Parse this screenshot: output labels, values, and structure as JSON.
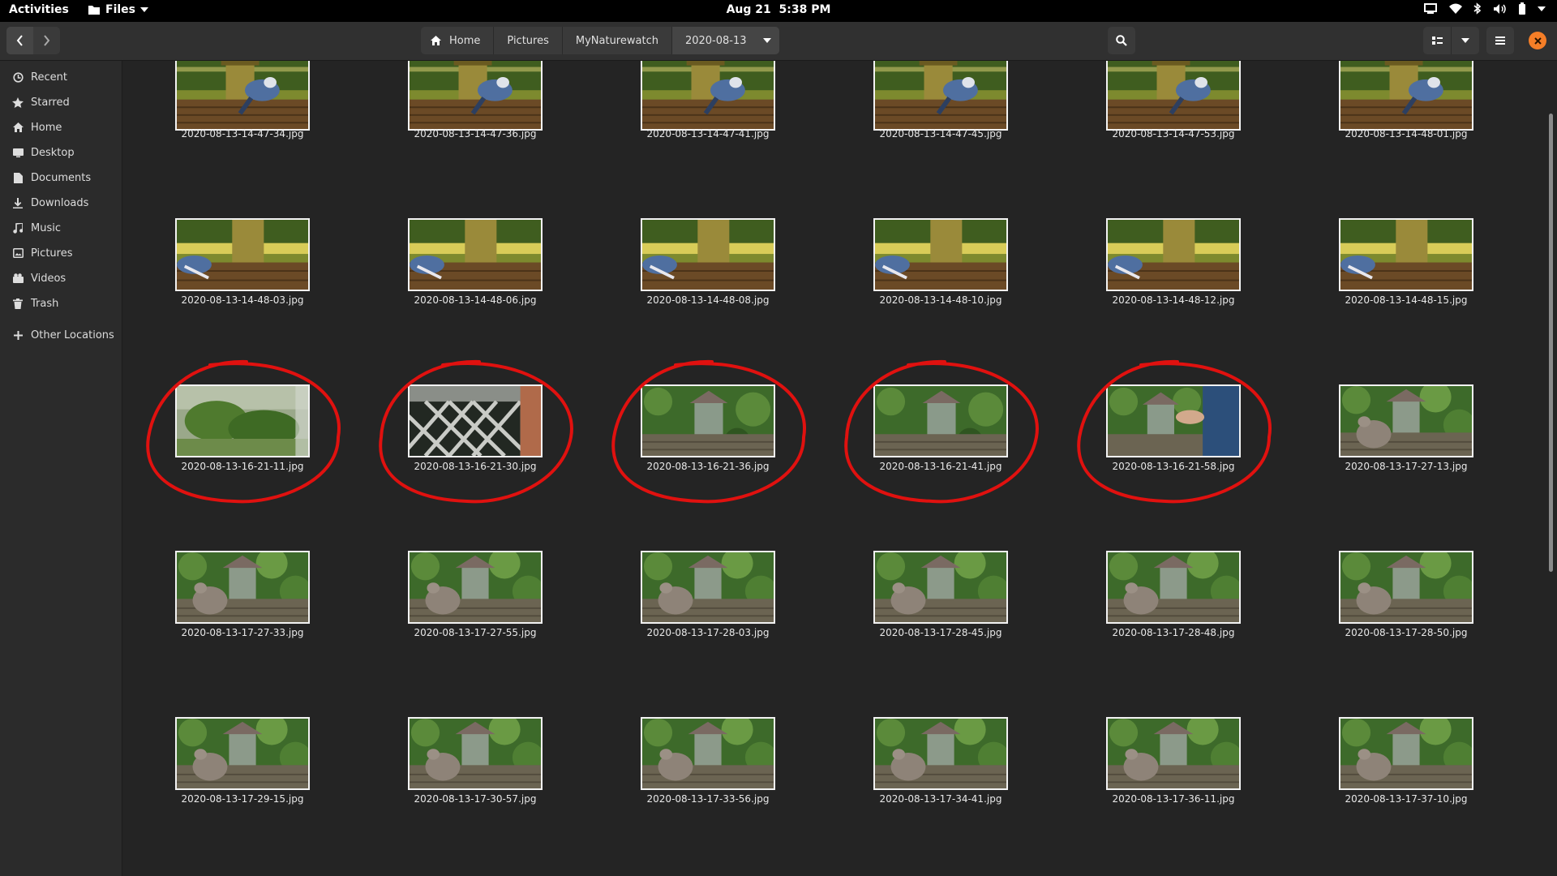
{
  "topbar": {
    "activities": "Activities",
    "app_name": "Files",
    "date": "Aug 21",
    "time": "5:38 PM"
  },
  "headerbar": {
    "breadcrumbs": [
      "Home",
      "Pictures",
      "MyNaturewatch",
      "2020-08-13"
    ]
  },
  "sidebar": {
    "items": [
      {
        "label": "Recent",
        "icon": "clock-icon"
      },
      {
        "label": "Starred",
        "icon": "star-icon"
      },
      {
        "label": "Home",
        "icon": "home-icon"
      },
      {
        "label": "Desktop",
        "icon": "desktop-icon"
      },
      {
        "label": "Documents",
        "icon": "document-icon"
      },
      {
        "label": "Downloads",
        "icon": "download-icon"
      },
      {
        "label": "Music",
        "icon": "music-icon"
      },
      {
        "label": "Pictures",
        "icon": "picture-icon"
      },
      {
        "label": "Videos",
        "icon": "video-icon"
      },
      {
        "label": "Trash",
        "icon": "trash-icon"
      },
      {
        "label": "Other Locations",
        "icon": "plus-icon"
      }
    ]
  },
  "files": [
    {
      "name": "2020-08-13-14-47-34.jpg",
      "scene": "jay"
    },
    {
      "name": "2020-08-13-14-47-36.jpg",
      "scene": "jay"
    },
    {
      "name": "2020-08-13-14-47-41.jpg",
      "scene": "jay"
    },
    {
      "name": "2020-08-13-14-47-45.jpg",
      "scene": "jay"
    },
    {
      "name": "2020-08-13-14-47-53.jpg",
      "scene": "jay"
    },
    {
      "name": "2020-08-13-14-48-01.jpg",
      "scene": "jay"
    },
    {
      "name": "2020-08-13-14-48-03.jpg",
      "scene": "jay2"
    },
    {
      "name": "2020-08-13-14-48-06.jpg",
      "scene": "jay2"
    },
    {
      "name": "2020-08-13-14-48-08.jpg",
      "scene": "jay2"
    },
    {
      "name": "2020-08-13-14-48-10.jpg",
      "scene": "jay2"
    },
    {
      "name": "2020-08-13-14-48-12.jpg",
      "scene": "jay2"
    },
    {
      "name": "2020-08-13-14-48-15.jpg",
      "scene": "jay2"
    },
    {
      "name": "2020-08-13-16-21-11.jpg",
      "scene": "blur"
    },
    {
      "name": "2020-08-13-16-21-30.jpg",
      "scene": "lattice"
    },
    {
      "name": "2020-08-13-16-21-36.jpg",
      "scene": "feeder"
    },
    {
      "name": "2020-08-13-16-21-41.jpg",
      "scene": "feeder"
    },
    {
      "name": "2020-08-13-16-21-58.jpg",
      "scene": "hand"
    },
    {
      "name": "2020-08-13-17-27-13.jpg",
      "scene": "squirrel"
    },
    {
      "name": "2020-08-13-17-27-33.jpg",
      "scene": "squirrel"
    },
    {
      "name": "2020-08-13-17-27-55.jpg",
      "scene": "squirrel"
    },
    {
      "name": "2020-08-13-17-28-03.jpg",
      "scene": "squirrel"
    },
    {
      "name": "2020-08-13-17-28-45.jpg",
      "scene": "squirrel"
    },
    {
      "name": "2020-08-13-17-28-48.jpg",
      "scene": "squirrel"
    },
    {
      "name": "2020-08-13-17-28-50.jpg",
      "scene": "squirrel"
    },
    {
      "name": "2020-08-13-17-29-15.jpg",
      "scene": "squirrel"
    },
    {
      "name": "2020-08-13-17-30-57.jpg",
      "scene": "squirrel"
    },
    {
      "name": "2020-08-13-17-33-56.jpg",
      "scene": "squirrel"
    },
    {
      "name": "2020-08-13-17-34-41.jpg",
      "scene": "squirrel"
    },
    {
      "name": "2020-08-13-17-36-11.jpg",
      "scene": "squirrel"
    },
    {
      "name": "2020-08-13-17-37-10.jpg",
      "scene": "squirrel"
    }
  ],
  "annotations": {
    "circled_files": [
      "2020-08-13-16-21-11.jpg",
      "2020-08-13-16-21-30.jpg",
      "2020-08-13-16-21-36.jpg",
      "2020-08-13-16-21-41.jpg",
      "2020-08-13-16-21-58.jpg"
    ],
    "color": "#e0110f"
  },
  "colors": {
    "accent": "#f57e27",
    "window_bg": "#242424",
    "sidebar_bg": "#2b2b2b",
    "headerbar_bg": "#303030"
  }
}
